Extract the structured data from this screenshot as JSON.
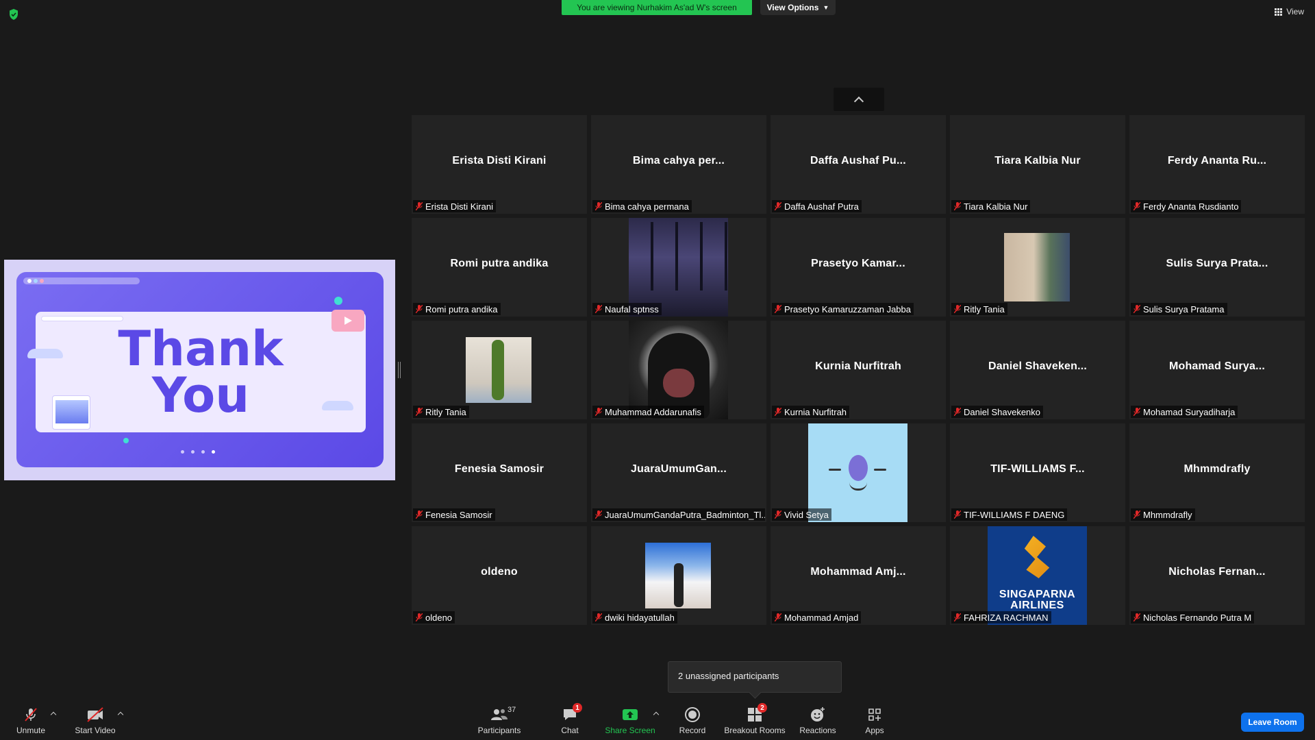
{
  "banner": {
    "viewing_text": "You are viewing Nurhakim As'ad W's screen",
    "view_options": "View Options",
    "view_toggle": "View"
  },
  "slide": {
    "line1": "Thank",
    "line2": "You"
  },
  "tiles": [
    {
      "display": "Erista Disti Kirani",
      "name": "Erista Disti Kirani"
    },
    {
      "display": "Bima cahya per...",
      "name": "Bima cahya permana"
    },
    {
      "display": "Daffa Aushaf Pu...",
      "name": "Daffa Aushaf Putra"
    },
    {
      "display": "Tiara Kalbia Nur",
      "name": "Tiara Kalbia Nur"
    },
    {
      "display": "Ferdy Ananta Ru...",
      "name": "Ferdy Ananta Rusdianto"
    },
    {
      "display": "Romi putra andika",
      "name": "Romi putra andika"
    },
    {
      "display": "",
      "name": "Naufal sptnss",
      "video": "city"
    },
    {
      "display": "Prasetyo Kamar...",
      "name": "Prasetyo Kamaruzzaman Jabba"
    },
    {
      "display": "",
      "name": "Ritly Tania",
      "video": "room"
    },
    {
      "display": "Sulis Surya Prata...",
      "name": "Sulis Surya Pratama"
    },
    {
      "display": "",
      "name": "Ritly Tania",
      "video": "croc"
    },
    {
      "display": "",
      "name": "Muhammad Addarunafis",
      "video": "hood"
    },
    {
      "display": "Kurnia Nurfitrah",
      "name": "Kurnia Nurfitrah"
    },
    {
      "display": "Daniel Shaveken...",
      "name": "Daniel Shavekenko"
    },
    {
      "display": "Mohamad Surya...",
      "name": "Mohamad Suryadiharja"
    },
    {
      "display": "Fenesia Samosir",
      "name": "Fenesia Samosir"
    },
    {
      "display": "JuaraUmumGan...",
      "name": "JuaraUmumGandaPutra_Badminton_Tl..."
    },
    {
      "display": "",
      "name": "Vivid Setya",
      "video": "face"
    },
    {
      "display": "TIF-WILLIAMS F...",
      "name": "TIF-WILLIAMS F DAENG"
    },
    {
      "display": "Mhmmdrafly",
      "name": "Mhmmdrafly"
    },
    {
      "display": "oldeno",
      "name": "oldeno"
    },
    {
      "display": "",
      "name": "dwiki hidayatullah",
      "video": "party"
    },
    {
      "display": "Mohammad Amj...",
      "name": "Mohammad Amjad"
    },
    {
      "display": "",
      "name": "FAHRIZA RACHMAN",
      "video": "sia",
      "brand_line1": "SINGAPARNA",
      "brand_line2": "AIRLINES"
    },
    {
      "display": "Nicholas Fernan...",
      "name": "Nicholas Fernando Putra M"
    }
  ],
  "tooltip": "2 unassigned participants",
  "toolbar": {
    "unmute": "Unmute",
    "start_video": "Start Video",
    "participants": "Participants",
    "participants_count": "37",
    "chat": "Chat",
    "chat_badge": "1",
    "share_screen": "Share Screen",
    "record": "Record",
    "breakout_rooms": "Breakout Rooms",
    "breakout_badge": "2",
    "reactions": "Reactions",
    "apps": "Apps",
    "leave_room": "Leave Room"
  },
  "colors": {
    "share_green": "#23c552",
    "leave_blue": "#0e72ed",
    "muted_red": "#e02828",
    "slide_purple": "#5b49e6"
  }
}
